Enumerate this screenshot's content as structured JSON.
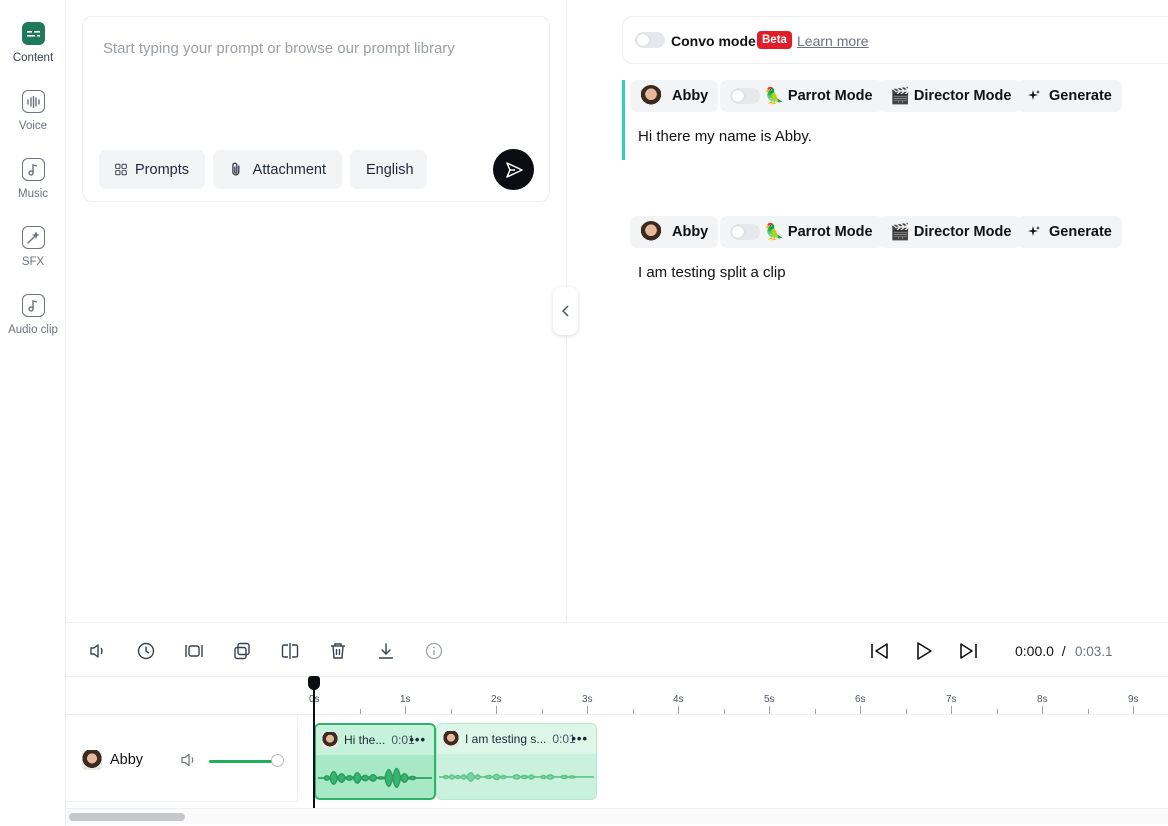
{
  "sidebar": {
    "items": [
      {
        "label": "Content",
        "icon": "content-icon",
        "active": true
      },
      {
        "label": "Voice",
        "icon": "voice-icon"
      },
      {
        "label": "Music",
        "icon": "music-icon"
      },
      {
        "label": "SFX",
        "icon": "sfx-icon"
      },
      {
        "label": "Audio clip",
        "icon": "audio-clip-icon"
      }
    ]
  },
  "prompt": {
    "placeholder": "Start typing your prompt or browse our prompt library",
    "prompts_label": "Prompts",
    "attachment_label": "Attachment",
    "language_label": "English"
  },
  "convo": {
    "label": "Convo mode",
    "beta": "Beta",
    "learn_more": "Learn more"
  },
  "blocks": [
    {
      "voice": "Abby",
      "parrot": "Parrot Mode",
      "director": "Director Mode",
      "generate": "Generate",
      "text": "Hi there my name is Abby."
    },
    {
      "voice": "Abby",
      "parrot": "Parrot Mode",
      "director": "Director Mode",
      "generate": "Generate",
      "text": "I am testing split a clip"
    }
  ],
  "emoji": {
    "parrot": "🦜",
    "director": "🎬"
  },
  "timeline": {
    "current_time": "0:00.0",
    "separator": "/",
    "total_time": "0:03.1",
    "ruler": [
      "0s",
      "1s",
      "2s",
      "3s",
      "4s",
      "5s",
      "6s",
      "7s",
      "8s",
      "9s"
    ],
    "track": {
      "name": "Abby",
      "volume": 0.95
    },
    "clips": [
      {
        "title": "Hi the...",
        "duration": "0:01",
        "more": "•••"
      },
      {
        "title": "I am testing s...",
        "duration": "0:01",
        "more": "•••"
      }
    ]
  },
  "colors": {
    "accent": "#1f7a5a",
    "teal": "#2ed3b7",
    "clip_active": "#6fdba0",
    "clip_idle": "#c9f1dc",
    "volume": "#1fae5a",
    "beta": "#e11d2a"
  }
}
